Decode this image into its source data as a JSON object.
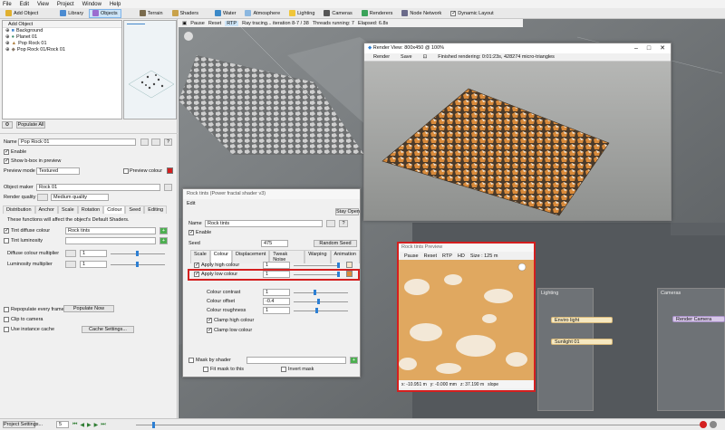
{
  "menu": [
    "File",
    "Edit",
    "View",
    "Project",
    "Window",
    "Help"
  ],
  "toolbar": {
    "add_object": "Add Object",
    "library": "Library",
    "objects": "Objects",
    "terrain": "Terrain",
    "shaders": "Shaders",
    "water": "Water",
    "atmosphere": "Atmosphere",
    "lighting": "Lighting",
    "cameras": "Cameras",
    "renderers": "Renderers",
    "node_network": "Node Network",
    "dynamic_layout": "Dynamic Layout"
  },
  "tree": {
    "items": [
      "Background",
      "Planet 01",
      "Pop Rock 01",
      "Pop Rock 01/Rock 01"
    ]
  },
  "populate_all": "Populate All",
  "obj": {
    "name_label": "Name",
    "name_value": "Pop Rock 01",
    "enable": "Enable",
    "show_bbox": "Show b-box in preview",
    "preview_mode_label": "Preview mode",
    "preview_mode_value": "Textured",
    "preview_colour": "Preview colour",
    "object_maker_label": "Object maker",
    "object_maker_value": "Rock 01",
    "render_quality_label": "Render quality",
    "render_quality_value": "Medium quality"
  },
  "obj_tabs": [
    "Distribution",
    "Anchor",
    "Scale",
    "Rotation",
    "Colour",
    "Seed",
    "Editing"
  ],
  "colour_tab": {
    "note": "These functions will affect the object's Default Shaders.",
    "tint_diffuse": "Tint diffuse colour",
    "tint_value": "Rock tints",
    "tint_luminosity": "Tint luminosity",
    "diffuse_mult": "Diffuse colour multiplier",
    "diffuse_val": "1",
    "lum_mult": "Luminosity multiplier",
    "lum_val": "1"
  },
  "repop": {
    "repopulate": "Repopulate every frame",
    "populate_now": "Populate Now",
    "clip": "Clip to camera",
    "instance_cache": "Use instance cache",
    "cache_settings": "Cache Settings..."
  },
  "viewport": {
    "pause": "Pause",
    "reset": "Reset",
    "rtp": "RTP",
    "status": "Ray tracing... iteration 8-7 / 38",
    "threads": "Threads running: 7",
    "elapsed": "Elapsed: 6.8s"
  },
  "render_view": {
    "title": "Render View: 800x450 @ 100%",
    "render": "Render",
    "save": "Save",
    "finished": "Finished rendering: 0:01:23s, 428274 micro-triangles"
  },
  "shader_win": {
    "title": "Rock tints   (Power fractal shader v3)",
    "edit": "Edit",
    "stay_open": "Stay Open",
    "name_label": "Name",
    "name_value": "Rock tints",
    "enable": "Enable",
    "seed_label": "Seed",
    "seed_value": "475",
    "random_seed": "Random Seed",
    "tabs": [
      "Scale",
      "Colour",
      "Displacement",
      "Tweak Noise",
      "Warping",
      "Animation"
    ],
    "apply_high": "Apply high colour",
    "high_val": "1",
    "apply_low": "Apply low colour",
    "low_val": "1",
    "contrast_label": "Colour contrast",
    "contrast_val": "1",
    "offset_label": "Colour offset",
    "offset_val": "-0.4",
    "rough_label": "Colour roughness",
    "rough_val": "1",
    "clamp_high": "Clamp high colour",
    "clamp_low": "Clamp low colour",
    "mask_label": "Mask by shader",
    "fit_mask": "Fit mask to this",
    "invert_mask": "Invert mask"
  },
  "preview_win": {
    "title": "Rock tints Preview",
    "pause": "Pause",
    "reset": "Reset",
    "rtp": "RTP",
    "hd": "HD",
    "size": "Size : 125 m",
    "coord_x": "x: -10.951 m",
    "coord_y": "y: -0.000 mm",
    "coord_z": "z: 37.190 m",
    "slope": "slope"
  },
  "nodes": {
    "lighting": "Lighting",
    "enviro": "Enviro light",
    "sunlight": "Sunlight 01",
    "cameras": "Cameras",
    "render_camera": "Render Camera"
  },
  "status": {
    "project_settings": "Project Settings...",
    "frame": "5"
  },
  "colors": {
    "highlight": "#d41f1f",
    "accent": "#2d7fd3",
    "rock_orange": "#d98a3a"
  }
}
